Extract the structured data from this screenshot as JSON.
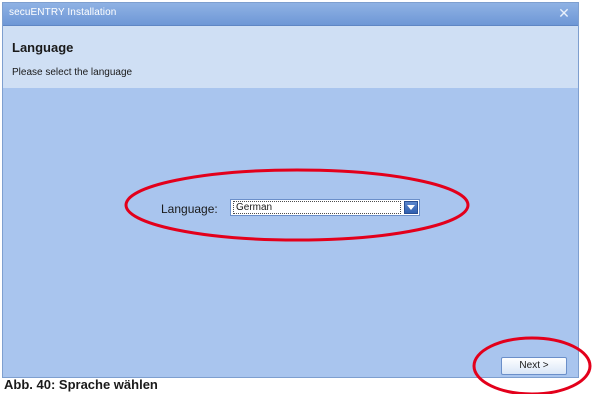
{
  "window": {
    "title": "secuENTRY Installation",
    "close_icon": "close-icon"
  },
  "header": {
    "heading": "Language",
    "subheading": "Please select the language"
  },
  "language": {
    "label": "Language:",
    "selected": "German",
    "arrow_icon": "chevron-down-icon"
  },
  "footer": {
    "next_label": "Next >"
  },
  "caption": {
    "text": "Abb. 40: Sprache wählen"
  },
  "colors": {
    "annotation": "#e3001b",
    "content_bg": "#a9c5ee",
    "header_bg": "#cfdff4",
    "titlebar": "#7fa5dd"
  }
}
